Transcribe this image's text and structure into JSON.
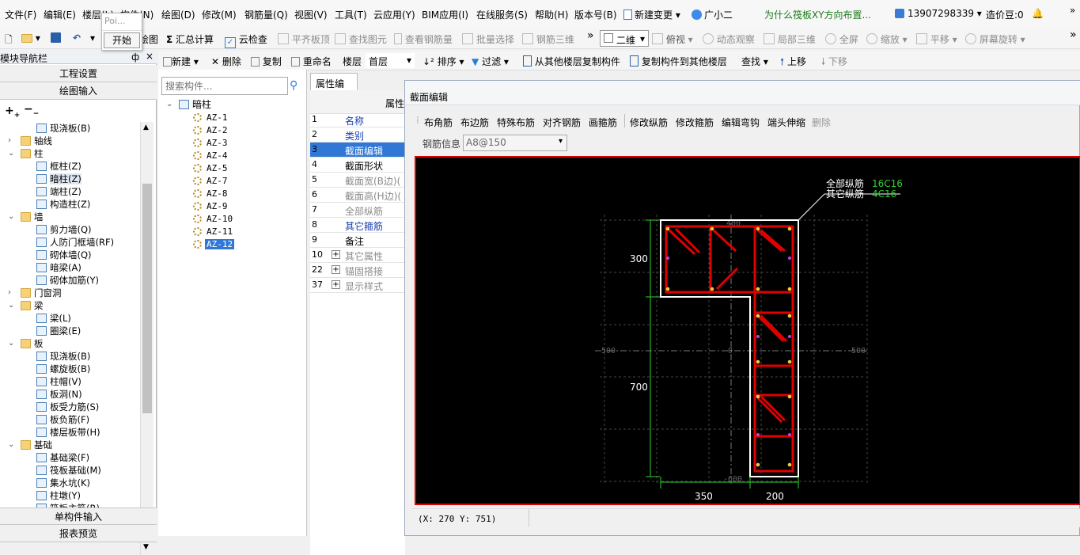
{
  "menu": [
    "文件(F)",
    "编辑(E)",
    "楼层(L)",
    "构件(N)",
    "绘图(D)",
    "修改(M)",
    "钢筋量(Q)",
    "视图(V)",
    "工具(T)",
    "云应用(Y)",
    "BIM应用(I)",
    "在线服务(S)",
    "帮助(H)",
    "版本号(B)",
    "新建变更",
    "广小二"
  ],
  "promo_text": "为什么筏板XY方向布置...",
  "account": "13907298339",
  "beans": "造价豆:0",
  "popup": {
    "title": "Poi...",
    "button": "开始"
  },
  "toolbar1": [
    "绘图",
    "汇总计算",
    "云检查",
    "平齐板顶",
    "查找图元",
    "查看钢筋量",
    "批量选择",
    "钢筋三维"
  ],
  "view_select": "二维",
  "toolbar1_right": [
    "俯视",
    "动态观察",
    "局部三维",
    "全屏",
    "缩放",
    "平移",
    "屏幕旋转"
  ],
  "left_panel": {
    "title": "模块导航栏",
    "pin": "ф",
    "close": "×",
    "btn_project": "工程设置",
    "btn_draw": "绘图输入",
    "btn_single": "单构件输入",
    "btn_report": "报表预览",
    "tree": [
      {
        "label": "现浇板(B)",
        "level": 2
      },
      {
        "label": "轴线",
        "level": 1,
        "folder": true,
        "collapsed": true
      },
      {
        "label": "柱",
        "level": 1,
        "folder": true
      },
      {
        "label": "框柱(Z)",
        "level": 2
      },
      {
        "label": "暗柱(Z)",
        "level": 2,
        "selected": true
      },
      {
        "label": "端柱(Z)",
        "level": 2
      },
      {
        "label": "构造柱(Z)",
        "level": 2
      },
      {
        "label": "墙",
        "level": 1,
        "folder": true
      },
      {
        "label": "剪力墙(Q)",
        "level": 2
      },
      {
        "label": "人防门框墙(RF)",
        "level": 2
      },
      {
        "label": "砌体墙(Q)",
        "level": 2
      },
      {
        "label": "暗梁(A)",
        "level": 2
      },
      {
        "label": "砌体加筋(Y)",
        "level": 2
      },
      {
        "label": "门窗洞",
        "level": 1,
        "folder": true,
        "collapsed": true
      },
      {
        "label": "梁",
        "level": 1,
        "folder": true
      },
      {
        "label": "梁(L)",
        "level": 2
      },
      {
        "label": "圈梁(E)",
        "level": 2
      },
      {
        "label": "板",
        "level": 1,
        "folder": true
      },
      {
        "label": "现浇板(B)",
        "level": 2
      },
      {
        "label": "螺旋板(B)",
        "level": 2
      },
      {
        "label": "柱帽(V)",
        "level": 2
      },
      {
        "label": "板洞(N)",
        "level": 2
      },
      {
        "label": "板受力筋(S)",
        "level": 2
      },
      {
        "label": "板负筋(F)",
        "level": 2
      },
      {
        "label": "楼层板带(H)",
        "level": 2
      },
      {
        "label": "基础",
        "level": 1,
        "folder": true
      },
      {
        "label": "基础梁(F)",
        "level": 2
      },
      {
        "label": "筏板基础(M)",
        "level": 2
      },
      {
        "label": "集水坑(K)",
        "level": 2
      },
      {
        "label": "柱墩(Y)",
        "level": 2
      },
      {
        "label": "筏板主筋(R)",
        "level": 2
      }
    ]
  },
  "toolbar2": {
    "new": "新建",
    "delete": "删除",
    "copy": "复制",
    "rename": "重命名",
    "floor_label": "楼层",
    "floor_value": "首层",
    "sort": "排序",
    "filter": "过滤",
    "copy_from": "从其他楼层复制构件",
    "copy_to": "复制构件到其他楼层",
    "find": "查找",
    "up": "上移",
    "down": "下移"
  },
  "search": {
    "placeholder": "搜索构件..."
  },
  "comp_tree": {
    "root": "暗柱",
    "items": [
      "AZ-1",
      "AZ-2",
      "AZ-3",
      "AZ-4",
      "AZ-5",
      "AZ-7",
      "AZ-8",
      "AZ-9",
      "AZ-10",
      "AZ-11",
      "AZ-12"
    ],
    "selected": "AZ-12"
  },
  "attr": {
    "tab": "属性编辑",
    "header": "属性",
    "rows": [
      {
        "num": "1",
        "name": "名称",
        "style": "blue"
      },
      {
        "num": "2",
        "name": "类别",
        "style": "blue"
      },
      {
        "num": "3",
        "name": "截面编辑",
        "style": "selected"
      },
      {
        "num": "4",
        "name": "截面形状",
        "style": "normal"
      },
      {
        "num": "5",
        "name": "截面宽(B边)(",
        "style": "gray"
      },
      {
        "num": "6",
        "name": "截面高(H边)(",
        "style": "gray"
      },
      {
        "num": "7",
        "name": "全部纵筋",
        "style": "gray"
      },
      {
        "num": "8",
        "name": "其它箍筋",
        "style": "blue"
      },
      {
        "num": "9",
        "name": "备注",
        "style": "normal"
      },
      {
        "num": "10",
        "name": "其它属性",
        "style": "gray",
        "plus": true
      },
      {
        "num": "22",
        "name": "锚固搭接",
        "style": "gray",
        "plus": true
      },
      {
        "num": "37",
        "name": "显示样式",
        "style": "gray",
        "plus": true
      }
    ]
  },
  "section": {
    "title": "截面编辑",
    "tools": [
      "布角筋",
      "布边筋",
      "特殊布筋",
      "对齐钢筋",
      "画箍筋",
      "修改纵筋",
      "修改箍筋",
      "编辑弯钩",
      "端头伸缩",
      "删除"
    ],
    "rebar_info_label": "钢筋信息",
    "rebar_info_value": "A8@150",
    "info_all": "全部纵筋",
    "info_all_val": "16C16",
    "info_other": "其它纵筋",
    "info_other_val": "4C16",
    "dim_300": "300",
    "dim_700": "700",
    "dim_350": "350",
    "dim_200": "200",
    "axis_m500": "-500",
    "axis_0": "0",
    "axis_500": "500",
    "axis_400": "400",
    "axis_m600": "-600",
    "status": "(X: 270 Y: 751)"
  }
}
